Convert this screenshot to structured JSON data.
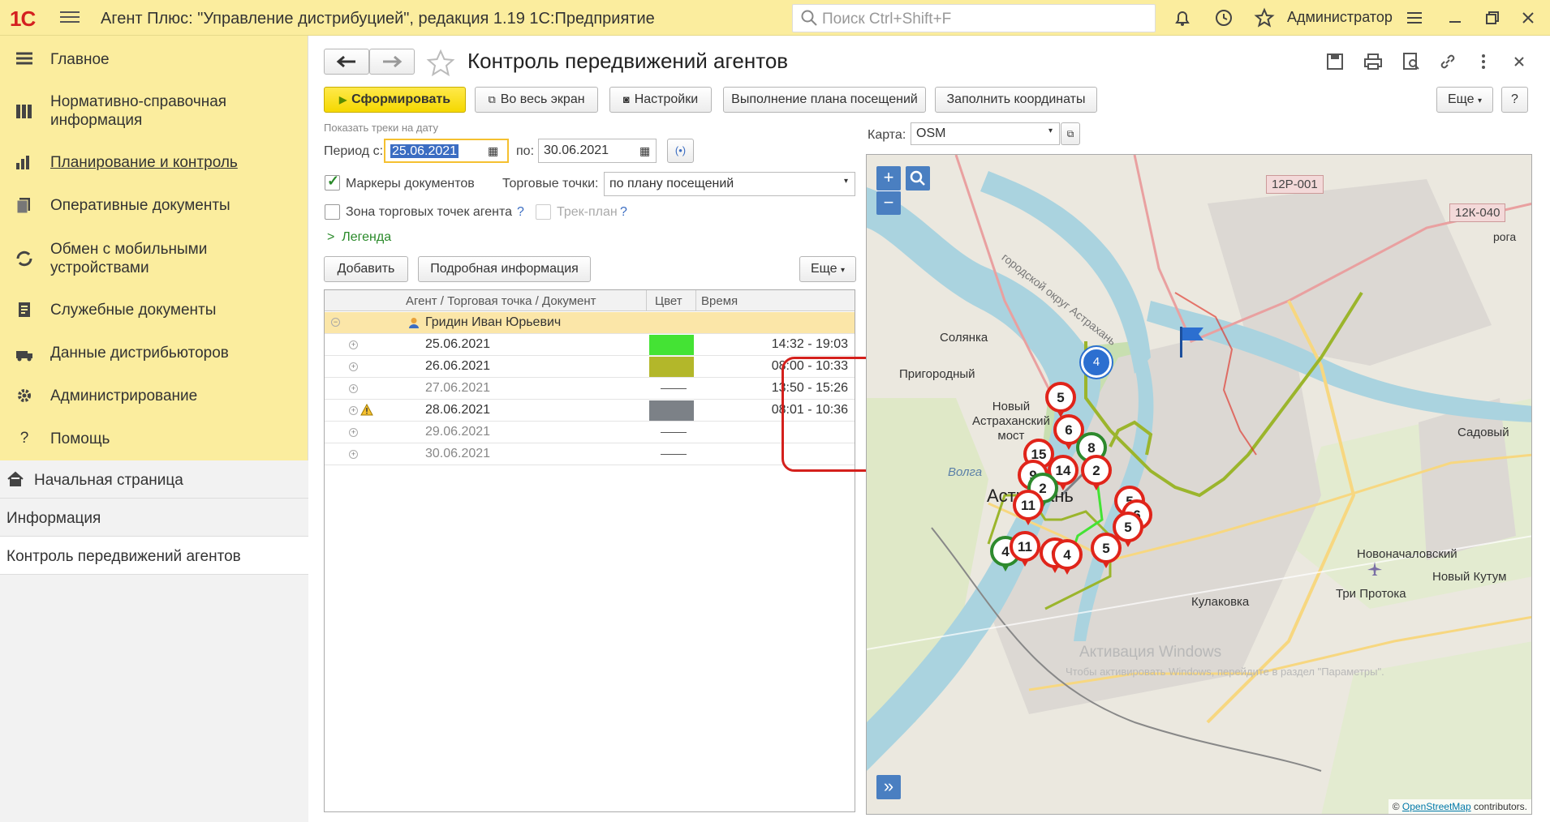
{
  "app": {
    "logo": "1С",
    "title": "Агент Плюс: \"Управление дистрибуцией\", редакция 1.19 1С:Предприятие",
    "search_placeholder": "Поиск Ctrl+Shift+F",
    "user": "Администратор"
  },
  "sidebar": {
    "items": [
      {
        "label": "Главное",
        "icon": "menu-lines-icon"
      },
      {
        "label": "Нормативно-справочная информация",
        "icon": "books-icon"
      },
      {
        "label": "Планирование и контроль",
        "icon": "bar-chart-icon"
      },
      {
        "label": "Оперативные документы",
        "icon": "documents-icon"
      },
      {
        "label": "Обмен с мобильными устройствами",
        "icon": "sync-icon"
      },
      {
        "label": "Служебные документы",
        "icon": "service-docs-icon"
      },
      {
        "label": "Данные дистрибьюторов",
        "icon": "distributor-icon"
      },
      {
        "label": "Администрирование",
        "icon": "gear-icon"
      },
      {
        "label": "Помощь",
        "icon": "question-icon"
      }
    ],
    "lower": [
      {
        "label": "Начальная страница",
        "icon": "home-icon"
      },
      {
        "label": "Информация"
      },
      {
        "label": "Контроль передвижений агентов"
      }
    ]
  },
  "page": {
    "title": "Контроль передвижений агентов",
    "buttons": {
      "generate": "Сформировать",
      "fullscreen": "Во весь экран",
      "settings": "Настройки",
      "plan": "Выполнение плана посещений",
      "fill_coords": "Заполнить координаты",
      "more": "Еще",
      "help": "?",
      "add": "Добавить",
      "details": "Подробная информация",
      "more2": "Еще"
    },
    "filters": {
      "section_label": "Показать треки на дату",
      "period_from_label": "Период с:",
      "period_from": "25.06.2021",
      "period_to_label": "по:",
      "period_to": "30.06.2021",
      "doc_markers_label": "Маркеры документов",
      "doc_markers_checked": true,
      "trade_points_label": "Торговые точки:",
      "trade_points_value": "по плану посещений",
      "zone_label": "Зона торговых точек агента",
      "zone_q": "?",
      "track_plan_label": "Трек-план",
      "track_plan_q": "?",
      "legend_label": "Легенда"
    },
    "map_selector": {
      "label": "Карта:",
      "value": "OSM"
    }
  },
  "table": {
    "columns": [
      "Агент / Торговая точка / Документ",
      "Цвет",
      "Время"
    ],
    "agent": "Гридин Иван Юрьевич",
    "rows": [
      {
        "date": "25.06.2021",
        "color": "#44e334",
        "time": "14:32 - 19:03",
        "active": true,
        "warn": false
      },
      {
        "date": "26.06.2021",
        "color": "#b3b72a",
        "time": "08:00 - 10:33",
        "active": true,
        "warn": false
      },
      {
        "date": "27.06.2021",
        "color": "",
        "time": "13:50 - 15:26",
        "active": false,
        "warn": false
      },
      {
        "date": "28.06.2021",
        "color": "#7c8187",
        "time": "08:01 - 10:36",
        "active": true,
        "warn": true
      },
      {
        "date": "29.06.2021",
        "color": "",
        "time": "",
        "active": false,
        "warn": false
      },
      {
        "date": "30.06.2021",
        "color": "",
        "time": "",
        "active": false,
        "warn": false
      }
    ]
  },
  "map": {
    "labels": {
      "solyanka": "Солянка",
      "prigorodny": "Пригородный",
      "novy_most": "Новый\nАстраханский\nмост",
      "volga": "Волга",
      "astrakhan": "Астрахань",
      "sadovy": "Садовый",
      "novonach": "Новоначаловский",
      "novy_kutum": "Новый Кутум",
      "tri_protoka": "Три Протока",
      "kulakovka": "Кулаковка",
      "gorod_okrug": "городской округ Астрахань",
      "road1": "12Р-001",
      "road2": "12К-040",
      "roga": "рога",
      "watermark1": "Активация Windows",
      "watermark2": "Чтобы активировать Windows, перейдите в раздел \"Параметры\".",
      "attribution_prefix": "©",
      "attribution_link": "OpenStreetMap",
      "attribution_suffix": "contributors."
    },
    "zoom_in": "+",
    "zoom_out": "−",
    "expand": "»",
    "cluster": "4",
    "pins": [
      {
        "n": "5",
        "c": "red"
      },
      {
        "n": "6",
        "c": "red"
      },
      {
        "n": "8",
        "c": "green"
      },
      {
        "n": "15",
        "c": "red"
      },
      {
        "n": "14",
        "c": "red"
      },
      {
        "n": "2",
        "c": "red"
      },
      {
        "n": "9",
        "c": "red"
      },
      {
        "n": "2",
        "c": "green"
      },
      {
        "n": "11",
        "c": "red"
      },
      {
        "n": "5",
        "c": "red"
      },
      {
        "n": "6",
        "c": "red"
      },
      {
        "n": "5",
        "c": "red"
      },
      {
        "n": "5",
        "c": "red"
      },
      {
        "n": "4",
        "c": "green"
      },
      {
        "n": "11",
        "c": "red"
      },
      {
        "n": "6",
        "c": "red"
      },
      {
        "n": "4",
        "c": "red"
      }
    ]
  },
  "colors": {
    "accent_yellow": "#fbed9e",
    "primary_btn": "#f5d800",
    "pin_red": "#e0241a",
    "pin_green": "#2d8a2d",
    "highlight_oval": "#d4201c"
  }
}
